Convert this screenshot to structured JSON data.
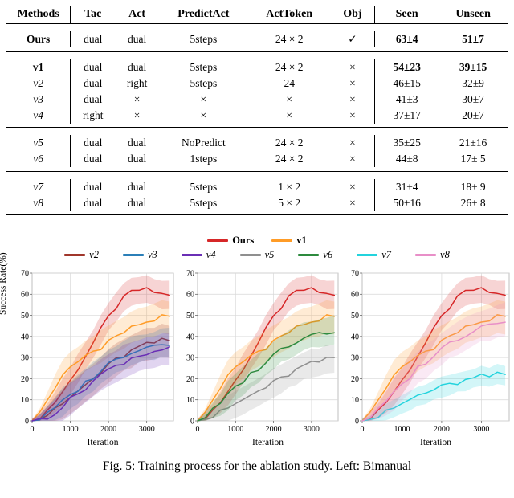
{
  "table": {
    "headers": [
      "Methods",
      "Tac",
      "Act",
      "PredictAct",
      "ActToken",
      "Obj",
      "Seen",
      "Unseen"
    ],
    "rows": [
      {
        "method": "Ours",
        "style": "bold",
        "tac": "dual",
        "act": "dual",
        "predictact": "5steps",
        "acttoken": "24 × 2",
        "obj": "✓",
        "seen": "63±4",
        "unseen": "51±7",
        "seen_bold": true,
        "unseen_bold": true,
        "group": 0
      },
      {
        "method": "v1",
        "style": "bold",
        "tac": "dual",
        "act": "dual",
        "predictact": "5steps",
        "acttoken": "24 × 2",
        "obj": "×",
        "seen": "54±23",
        "unseen": "39±15",
        "seen_bold": true,
        "unseen_bold": true,
        "group": 1
      },
      {
        "method": "v2",
        "style": "italic",
        "tac": "dual",
        "act": "right",
        "predictact": "5steps",
        "acttoken": "24",
        "obj": "×",
        "seen": "46±15",
        "unseen": "32±9",
        "seen_bold": false,
        "unseen_bold": false,
        "group": 1
      },
      {
        "method": "v3",
        "style": "italic",
        "tac": "dual",
        "act": "×",
        "predictact": "×",
        "acttoken": "×",
        "obj": "×",
        "seen": "41±3",
        "unseen": "30±7",
        "seen_bold": false,
        "unseen_bold": false,
        "group": 1
      },
      {
        "method": "v4",
        "style": "italic",
        "tac": "right",
        "act": "×",
        "predictact": "×",
        "acttoken": "×",
        "obj": "×",
        "seen": "37±17",
        "unseen": "20±7",
        "seen_bold": false,
        "unseen_bold": false,
        "group": 1
      },
      {
        "method": "v5",
        "style": "italic",
        "tac": "dual",
        "act": "dual",
        "predictact": "NoPredict",
        "acttoken": "24 × 2",
        "obj": "×",
        "seen": "35±25",
        "unseen": "21±16",
        "seen_bold": false,
        "unseen_bold": false,
        "group": 2
      },
      {
        "method": "v6",
        "style": "italic",
        "tac": "dual",
        "act": "dual",
        "predictact": "1steps",
        "acttoken": "24 × 2",
        "obj": "×",
        "seen": "44±8",
        "unseen": "17± 5",
        "seen_bold": false,
        "unseen_bold": false,
        "group": 2
      },
      {
        "method": "v7",
        "style": "italic",
        "tac": "dual",
        "act": "dual",
        "predictact": "5steps",
        "acttoken": "1 × 2",
        "obj": "×",
        "seen": "31±4",
        "unseen": "18± 9",
        "seen_bold": false,
        "unseen_bold": false,
        "group": 3
      },
      {
        "method": "v8",
        "style": "italic",
        "tac": "dual",
        "act": "dual",
        "predictact": "5steps",
        "acttoken": "5 × 2",
        "obj": "×",
        "seen": "50±16",
        "unseen": "26± 8",
        "seen_bold": false,
        "unseen_bold": false,
        "group": 3
      }
    ]
  },
  "legend": {
    "row1": [
      {
        "label": "Ours",
        "color": "#d62728",
        "bold": true,
        "italic": false
      },
      {
        "label": "v1",
        "color": "#ff9c27",
        "bold": true,
        "italic": false
      }
    ],
    "row2": [
      {
        "label": "v2",
        "color": "#a0362b",
        "bold": false,
        "italic": true
      },
      {
        "label": "v3",
        "color": "#2b7fb8",
        "bold": false,
        "italic": true
      },
      {
        "label": "v4",
        "color": "#6a2fb5",
        "bold": false,
        "italic": true
      },
      {
        "label": "v5",
        "color": "#8f8f8f",
        "bold": false,
        "italic": true
      },
      {
        "label": "v6",
        "color": "#2d8a3e",
        "bold": false,
        "italic": true
      },
      {
        "label": "v7",
        "color": "#23d3dd",
        "bold": false,
        "italic": true
      },
      {
        "label": "v8",
        "color": "#e88fc8",
        "bold": false,
        "italic": true
      }
    ]
  },
  "caption": "Fig. 5: Training process for the ablation study. Left: Bimanual",
  "chart_data": [
    {
      "id": "left",
      "type": "line",
      "title": "",
      "xlabel": "Iteration",
      "ylabel": "Success Rate(%)",
      "xlim": [
        0,
        3700
      ],
      "ylim": [
        0,
        70
      ],
      "xticks": [
        0,
        1000,
        2000,
        3000
      ],
      "yticks": [
        0,
        10,
        20,
        30,
        40,
        50,
        60,
        70
      ],
      "grid": true,
      "legend": "external-top",
      "x": [
        0,
        200,
        400,
        600,
        800,
        1000,
        1200,
        1400,
        1600,
        1800,
        2000,
        2200,
        2400,
        2600,
        2800,
        3000,
        3200,
        3400,
        3600
      ],
      "series": [
        {
          "name": "Ours",
          "color": "#d62728",
          "values": [
            0,
            2,
            5,
            9,
            14,
            19,
            25,
            31,
            37,
            43,
            49,
            54,
            58,
            61,
            62,
            62,
            61,
            60,
            60
          ],
          "band": 6
        },
        {
          "name": "v1",
          "color": "#ff9c27",
          "values": [
            0,
            4,
            10,
            16,
            21,
            25,
            28,
            31,
            33,
            35,
            38,
            40,
            42,
            44,
            46,
            47,
            48,
            49,
            49
          ],
          "band": 7
        },
        {
          "name": "v2",
          "color": "#a0362b",
          "values": [
            0,
            1,
            3,
            5,
            8,
            11,
            14,
            17,
            20,
            23,
            26,
            29,
            31,
            33,
            35,
            36,
            37,
            38,
            38
          ],
          "band": 7
        },
        {
          "name": "v3",
          "color": "#2b7fb8",
          "values": [
            0,
            1,
            3,
            6,
            9,
            12,
            15,
            18,
            21,
            24,
            27,
            29,
            31,
            33,
            34,
            35,
            36,
            37,
            37
          ],
          "band": 6
        },
        {
          "name": "v4",
          "color": "#6a2fb5",
          "values": [
            0,
            1,
            2,
            4,
            7,
            10,
            13,
            16,
            19,
            22,
            24,
            26,
            28,
            30,
            31,
            32,
            33,
            34,
            34
          ],
          "band": 7
        }
      ]
    },
    {
      "id": "middle",
      "type": "line",
      "title": "",
      "xlabel": "Iteration",
      "ylabel": "",
      "xlim": [
        0,
        3700
      ],
      "ylim": [
        0,
        70
      ],
      "xticks": [
        0,
        1000,
        2000,
        3000
      ],
      "yticks": [
        0,
        10,
        20,
        30,
        40,
        50,
        60,
        70
      ],
      "grid": true,
      "x": [
        0,
        200,
        400,
        600,
        800,
        1000,
        1200,
        1400,
        1600,
        1800,
        2000,
        2200,
        2400,
        2600,
        2800,
        3000,
        3200,
        3400,
        3600
      ],
      "series": [
        {
          "name": "Ours",
          "color": "#d62728",
          "values": [
            0,
            2,
            5,
            9,
            14,
            19,
            25,
            31,
            37,
            43,
            49,
            54,
            58,
            61,
            62,
            62,
            61,
            60,
            60
          ],
          "band": 6
        },
        {
          "name": "v1",
          "color": "#ff9c27",
          "values": [
            0,
            4,
            10,
            16,
            21,
            25,
            28,
            31,
            33,
            35,
            38,
            40,
            42,
            44,
            46,
            47,
            48,
            49,
            49
          ],
          "band": 7
        },
        {
          "name": "v5",
          "color": "#8f8f8f",
          "values": [
            0,
            1,
            2,
            4,
            6,
            8,
            10,
            12,
            14,
            16,
            18,
            20,
            22,
            24,
            26,
            27,
            28,
            29,
            30
          ],
          "band": 6
        },
        {
          "name": "v6",
          "color": "#2d8a3e",
          "values": [
            0,
            2,
            5,
            8,
            12,
            16,
            19,
            22,
            25,
            28,
            31,
            34,
            36,
            38,
            40,
            41,
            42,
            42,
            43
          ],
          "band": 6
        }
      ]
    },
    {
      "id": "right",
      "type": "line",
      "title": "",
      "xlabel": "Iteration",
      "ylabel": "",
      "xlim": [
        0,
        3700
      ],
      "ylim": [
        0,
        70
      ],
      "xticks": [
        0,
        1000,
        2000,
        3000
      ],
      "yticks": [
        0,
        10,
        20,
        30,
        40,
        50,
        60,
        70
      ],
      "grid": true,
      "x": [
        0,
        200,
        400,
        600,
        800,
        1000,
        1200,
        1400,
        1600,
        1800,
        2000,
        2200,
        2400,
        2600,
        2800,
        3000,
        3200,
        3400,
        3600
      ],
      "series": [
        {
          "name": "Ours",
          "color": "#d62728",
          "values": [
            0,
            2,
            5,
            9,
            14,
            19,
            25,
            31,
            37,
            43,
            49,
            54,
            58,
            61,
            62,
            62,
            61,
            60,
            60
          ],
          "band": 6
        },
        {
          "name": "v1",
          "color": "#ff9c27",
          "values": [
            0,
            4,
            10,
            16,
            21,
            25,
            28,
            31,
            33,
            35,
            38,
            40,
            42,
            44,
            46,
            47,
            48,
            49,
            49
          ],
          "band": 7
        },
        {
          "name": "v7",
          "color": "#23d3dd",
          "values": [
            0,
            1,
            2,
            4,
            6,
            8,
            10,
            12,
            13,
            15,
            16,
            17,
            18,
            19,
            20,
            21,
            21,
            22,
            22
          ],
          "band": 4
        },
        {
          "name": "v8",
          "color": "#e88fc8",
          "values": [
            0,
            2,
            5,
            9,
            13,
            17,
            21,
            25,
            28,
            31,
            34,
            37,
            39,
            41,
            43,
            45,
            46,
            47,
            48
          ],
          "band": 7
        }
      ]
    }
  ]
}
